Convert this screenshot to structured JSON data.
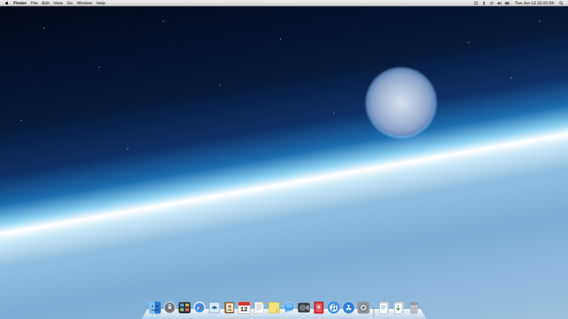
{
  "menu_bar": {
    "app": "Finder",
    "menus": [
      "File",
      "Edit",
      "View",
      "Go",
      "Window",
      "Help"
    ],
    "clock": "Tue Jun 12 22:01:56"
  },
  "dock": {
    "apps": [
      {
        "kind": "finder",
        "running": true
      },
      {
        "kind": "launchpad",
        "running": false
      },
      {
        "kind": "missioncontrol",
        "running": false
      },
      {
        "kind": "safari",
        "running": false
      },
      {
        "kind": "mail",
        "running": false
      },
      {
        "kind": "contacts",
        "running": false
      },
      {
        "kind": "calendar",
        "running": false,
        "day": "12"
      },
      {
        "kind": "textedit",
        "running": false
      },
      {
        "kind": "stickies",
        "running": false
      },
      {
        "kind": "messages",
        "running": false
      },
      {
        "kind": "facetime",
        "running": false
      },
      {
        "kind": "photobooth",
        "running": false
      },
      {
        "kind": "itunes",
        "running": false
      },
      {
        "kind": "appstore",
        "running": false
      },
      {
        "kind": "preferences",
        "running": false
      }
    ],
    "stacks": [
      {
        "kind": "documents"
      },
      {
        "kind": "downloads"
      },
      {
        "kind": "trash"
      }
    ]
  }
}
